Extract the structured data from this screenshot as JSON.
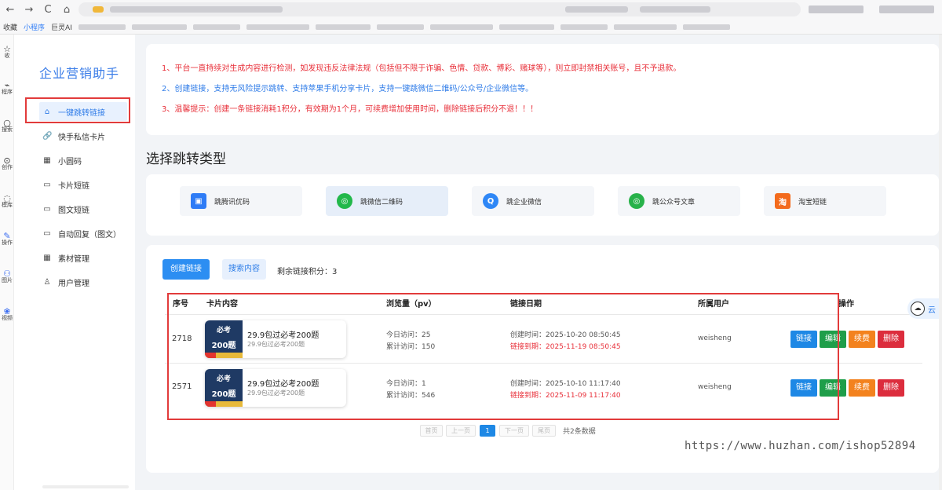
{
  "browser": {
    "nav_back": "←",
    "nav_forward": "→",
    "nav_reload": "C",
    "nav_home": "⌂",
    "ai_badge": "AI",
    "bookmarks": [
      "收藏",
      "小程序",
      "巨灵AI"
    ]
  },
  "left_strip": [
    {
      "icon": "☆",
      "label": "收"
    },
    {
      "icon": "⌁",
      "label": "程序"
    },
    {
      "icon": "○",
      "label": "搜索"
    },
    {
      "icon": "⊙",
      "label": "创作"
    },
    {
      "icon": "◌",
      "label": "模库"
    },
    {
      "icon": "✎",
      "label": "操作"
    },
    {
      "icon": "⚇",
      "label": "图片"
    },
    {
      "icon": "❀",
      "label": "视频"
    }
  ],
  "sidebar": {
    "brand": "企业营销助手",
    "items": [
      {
        "label": "一键跳转链接",
        "icon": "⌂",
        "active": true
      },
      {
        "label": "快手私信卡片",
        "icon": "🔗",
        "active": false
      },
      {
        "label": "小圆码",
        "icon": "▦",
        "active": false
      },
      {
        "label": "卡片短链",
        "icon": "▭",
        "active": false
      },
      {
        "label": "图文短链",
        "icon": "▭",
        "active": false
      },
      {
        "label": "自动回复（图文）",
        "icon": "▭",
        "active": false
      },
      {
        "label": "素材管理",
        "icon": "▦",
        "active": false
      },
      {
        "label": "用户管理",
        "icon": "♙",
        "active": false
      }
    ]
  },
  "notice": {
    "line1": "1、平台一直持续对生成内容进行检测，如发现违反法律法规（包括但不限于诈骗、色情、贷款、博彩、赌球等），则立即封禁相关账号，且不予退款。",
    "line2": "2、创建链接，支持无风险提示跳转、支持苹果手机分享卡片，支持一键跳微信二维码/公众号/企业微信等。",
    "line3": "3、温馨提示：创建一条链接消耗1积分，有效期为1个月，可续费增加使用时间，删除链接后积分不退！！！"
  },
  "section_title": "选择跳转类型",
  "jump_types": [
    {
      "label": "跳腾讯优码",
      "icon": "▣",
      "color": "#2e7cf6",
      "selected": false
    },
    {
      "label": "跳微信二维码",
      "icon": "◎",
      "color": "#22b84a",
      "selected": true
    },
    {
      "label": "跳企业微信",
      "icon": "Q",
      "color": "#2e87f6",
      "selected": false
    },
    {
      "label": "跳公众号文章",
      "icon": "◎",
      "color": "#28b24a",
      "selected": false
    },
    {
      "label": "淘宝短链",
      "icon": "淘",
      "color": "#f36b1d",
      "selected": false
    }
  ],
  "toolbar": {
    "create_label": "创建链接",
    "search_label": "搜索内容",
    "credits_label": "剩余链接积分：",
    "credits_value": "3"
  },
  "table": {
    "headers": {
      "id": "序号",
      "card": "卡片内容",
      "views": "浏览量（pv）",
      "date": "链接日期",
      "user": "所属用户",
      "ops": "操作"
    },
    "rows": [
      {
        "id": "2718",
        "thumb_top": "必考",
        "thumb_mid": "200题",
        "title": "29.9包过必考200题",
        "subtitle": "29.9包过必考200题",
        "today": "今日访问：25",
        "total": "累计访问：150",
        "created": "创建时间：2025-10-20 08:50:45",
        "expires": "链接到期：2025-11-19 08:50:45",
        "user": "weisheng"
      },
      {
        "id": "2571",
        "thumb_top": "必考",
        "thumb_mid": "200题",
        "title": "29.9包过必考200题",
        "subtitle": "29.9包过必考200题",
        "today": "今日访问：1",
        "total": "累计访问：546",
        "created": "创建时间：2025-10-10 11:17:40",
        "expires": "链接到期：2025-11-09 11:17:40",
        "user": "weisheng"
      }
    ],
    "op_labels": {
      "link": "链接",
      "edit": "编辑",
      "renew": "续费",
      "del": "删除"
    }
  },
  "pagination": {
    "first": "首页",
    "prev": "上一页",
    "current": "1",
    "next": "下一页",
    "last": "尾页",
    "total": "共2条数据"
  },
  "watermark": "https://www.huzhan.com/ishop52894",
  "cloud_widget": {
    "icon": "☁",
    "label": "云"
  }
}
